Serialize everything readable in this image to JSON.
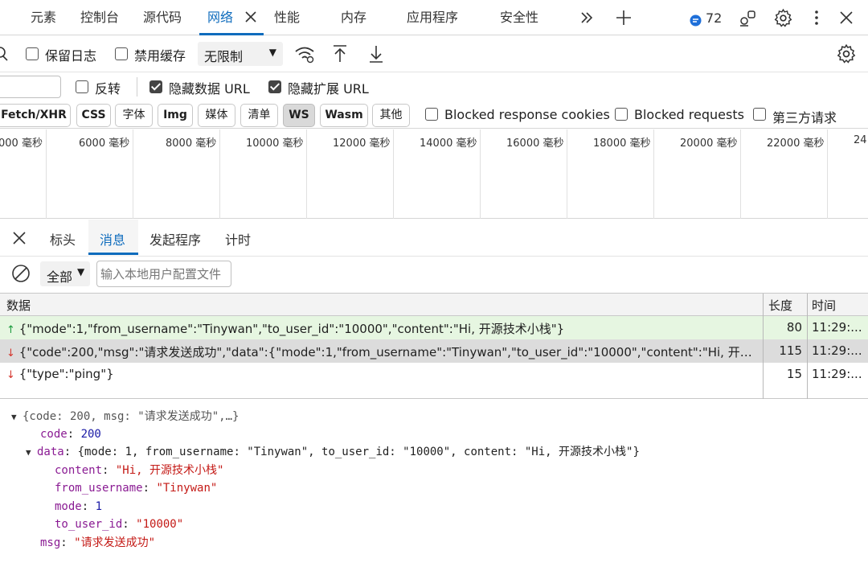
{
  "top_tabs": [
    {
      "label": "元素"
    },
    {
      "label": "控制台"
    },
    {
      "label": "源代码"
    },
    {
      "label": "网络"
    },
    {
      "label": "性能"
    },
    {
      "label": "内存"
    },
    {
      "label": "应用程序"
    },
    {
      "label": "安全性"
    }
  ],
  "toolbar_badge": "72",
  "toolbar2": {
    "preserve_log": "保留日志",
    "disable_cache": "禁用缓存",
    "throttle": "无限制"
  },
  "filter_row": {
    "invert": "反转",
    "hide_data_url": "隐藏数据 URL",
    "hide_ext_url": "隐藏扩展 URL"
  },
  "type_filters": [
    "Fetch/XHR",
    "CSS",
    "字体",
    "Img",
    "媒体",
    "清单",
    "WS",
    "Wasm",
    "其他"
  ],
  "extra_filters": {
    "blocked_cookies": "Blocked response cookies",
    "blocked_requests": "Blocked requests",
    "third_party": "第三方请求"
  },
  "timeline_ticks": [
    "000 毫秒",
    "6000 毫秒",
    "8000 毫秒",
    "10000 毫秒",
    "12000 毫秒",
    "14000 毫秒",
    "16000 毫秒",
    "18000 毫秒",
    "20000 毫秒",
    "22000 毫秒",
    "24"
  ],
  "detail_tabs": [
    "标头",
    "消息",
    "发起程序",
    "计时"
  ],
  "messages_filter": {
    "selected": "全部",
    "placeholder": "输入本地用户配置文件"
  },
  "messages_table": {
    "headers": [
      "数据",
      "长度",
      "时间"
    ],
    "rows": [
      {
        "direction": "sent",
        "data": "{\"mode\":1,\"from_username\":\"Tinywan\",\"to_user_id\":\"10000\",\"content\":\"Hi, 开源技术小栈\"}",
        "length": "80",
        "time": "11:29:..."
      },
      {
        "direction": "received",
        "data": "{\"code\":200,\"msg\":\"请求发送成功\",\"data\":{\"mode\":1,\"from_username\":\"Tinywan\",\"to_user_id\":\"10000\",\"content\":\"Hi, 开源技…",
        "length": "115",
        "time": "11:29:..."
      },
      {
        "direction": "received",
        "data": "{\"type\":\"ping\"}",
        "length": "15",
        "time": "11:29:..."
      }
    ]
  },
  "tree": {
    "summary": "{code: 200, msg: \"请求发送成功\",…}",
    "code_key": "code",
    "code_val": "200",
    "data_key": "data",
    "data_summary": "{mode: 1, from_username: \"Tinywan\", to_user_id: \"10000\", content: \"Hi, 开源技术小栈\"}",
    "content_key": "content",
    "content_val": "\"Hi, 开源技术小栈\"",
    "from_key": "from_username",
    "from_val": "\"Tinywan\"",
    "mode_key": "mode",
    "mode_val": "1",
    "to_key": "to_user_id",
    "to_val": "\"10000\"",
    "msg_key": "msg",
    "msg_val": "\"请求发送成功\""
  },
  "colors": {
    "accent": "#0f6cbd",
    "sent_row": "#e6f6e1",
    "selected_row": "#dcdcdc",
    "badge": "#1e6fd9"
  }
}
